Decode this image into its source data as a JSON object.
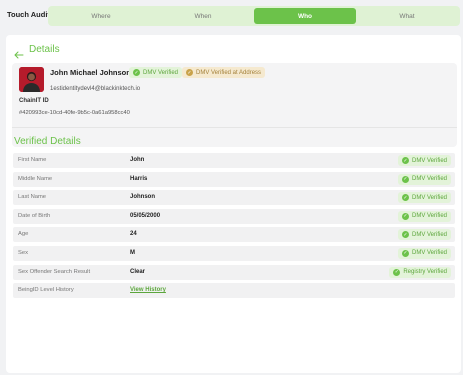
{
  "header": {
    "title": "Touch Audit",
    "tabs": [
      {
        "label": "Where",
        "active": false
      },
      {
        "label": "When",
        "active": false
      },
      {
        "label": "Who",
        "active": true
      },
      {
        "label": "What",
        "active": false
      }
    ]
  },
  "details": {
    "title": "Details",
    "back_icon": "arrow-left-icon"
  },
  "user": {
    "name": "John Michael Johnson",
    "email": "1estidentitydevl4@blackinktech.io",
    "badges": [
      {
        "label": "DMV Verified",
        "color": "#6cc24a"
      },
      {
        "label": "DMV Verified at Address",
        "color": "#c9a24a"
      }
    ],
    "chain_label": "ChainIT ID",
    "chain_value": "#420993ce-10cd-40fe-9b5c-0a61a958cc40"
  },
  "verified": {
    "title": "Verified Details",
    "rows": [
      {
        "label": "First Name",
        "value": "John",
        "badge": "DMV Verified",
        "link": false
      },
      {
        "label": "Middle Name",
        "value": "Harris",
        "badge": "DMV Verified",
        "link": false
      },
      {
        "label": "Last Name",
        "value": "Johnson",
        "badge": "DMV Verified",
        "link": false
      },
      {
        "label": "Date of Birth",
        "value": "05/05/2000",
        "badge": "DMV Verified",
        "link": false
      },
      {
        "label": "Age",
        "value": "24",
        "badge": "DMV Verified",
        "link": false
      },
      {
        "label": "Sex",
        "value": "M",
        "badge": "DMV Verified",
        "link": false
      },
      {
        "label": "Sex Offender Search Result",
        "value": "Clear",
        "badge": "Registry Verified",
        "link": false
      },
      {
        "label": "BeingID Level History",
        "value": "View History",
        "badge": "",
        "link": true
      }
    ]
  },
  "colors": {
    "accent": "#6cc24a",
    "amber": "#c9a24a"
  }
}
